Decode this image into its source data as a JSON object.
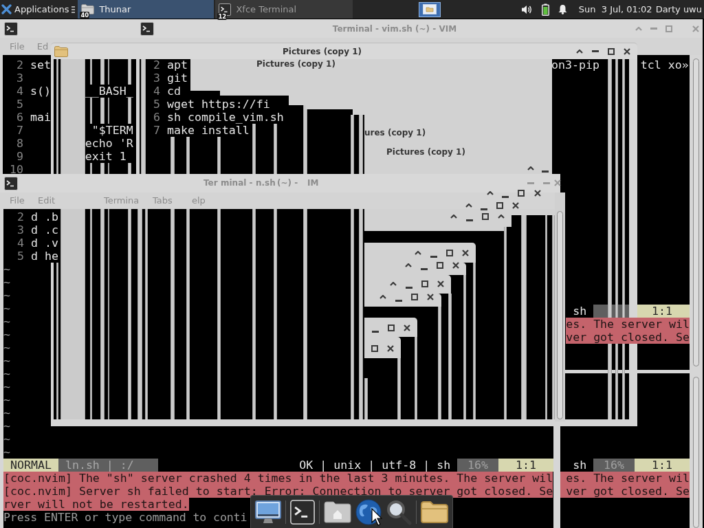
{
  "panel": {
    "applications": "Applications",
    "tasks": [
      {
        "kind": "folder",
        "badge": "40",
        "label": "Thunar",
        "selected": true
      },
      {
        "kind": "terminal",
        "badge": "12",
        "label": "Xfce Terminal",
        "selected": false
      }
    ],
    "clock": "Sun  3 Jul, 01:02",
    "user": "Darty uwu"
  },
  "terminal_back": {
    "menu": [
      "File",
      "Ed"
    ],
    "lines": [
      {
        "number": "2",
        "parts": [
          "set"
        ]
      },
      {
        "number": "3"
      },
      {
        "number": "4",
        "parts": [
          "s()",
          "__BASH_"
        ]
      },
      {
        "number": "5"
      },
      {
        "number": "6",
        "parts": [
          "mai"
        ]
      },
      {
        "number": "7",
        "parts": [
          "\"$TERM"
        ]
      },
      {
        "number": "8",
        "parts": [
          "echo 'R"
        ]
      },
      {
        "number": "9",
        "parts": [
          "exit 1"
        ]
      },
      {
        "number": "10"
      }
    ],
    "statusline": {
      "filetype": "sh",
      "percent": "16%",
      "position": "1:1"
    },
    "messages": [
      "es. The server wil",
      "ver got closed. Se"
    ]
  },
  "terminal_vim_sh": {
    "title": "Terminal - vim.sh (~) - VIM",
    "lines": [
      {
        "number": "2",
        "parts": [
          "apt",
          "on3-pip",
          "tcl xo»"
        ]
      },
      {
        "number": "3",
        "parts": [
          "git"
        ]
      },
      {
        "number": "4",
        "parts": [
          "cd"
        ]
      },
      {
        "number": "5",
        "parts": [
          "wget https://fi"
        ]
      },
      {
        "number": "6",
        "parts": [
          "sh compile_vim.sh"
        ]
      },
      {
        "number": "7",
        "parts": [
          "make install"
        ]
      }
    ],
    "statusline": {
      "filetype": "sh",
      "position": "1:1"
    },
    "messages": [
      "es. The server wil",
      "ver got closed. Se"
    ]
  },
  "file_manager": {
    "title": "Pictures (copy 1)",
    "trail_titles": [
      "Pictures (copy 1)",
      "ures (copy 1)",
      "Pictures (copy 1)"
    ]
  },
  "terminal_ln_sh": {
    "title_parts": [
      "Ter",
      "minal -",
      "n.sh",
      "(~) -",
      "IM"
    ],
    "menu": [
      "File",
      "Edit",
      "Termina",
      "Tabs",
      "elp"
    ],
    "lines": [
      {
        "number": "2",
        "parts": [
          "d .b"
        ]
      },
      {
        "number": "3",
        "parts": [
          "d .c"
        ]
      },
      {
        "number": "4",
        "parts": [
          "d .v"
        ]
      },
      {
        "number": "5",
        "parts": [
          "d he"
        ]
      }
    ],
    "tildes": [
      "~",
      "~",
      "~",
      "~",
      "~",
      "~",
      "~",
      "~",
      "~",
      "~",
      "~",
      "~",
      "~",
      "~",
      "~"
    ],
    "statusline": {
      "mode": "NORMAL",
      "file": "ln.sh | :/",
      "info": "OK | unix | utf-8 | sh",
      "percent": "16%",
      "position": "1:1"
    },
    "messages": [
      "[coc.nvim] The \"sh\" server crashed 4 times in the last 3 minutes. The server wil",
      "[coc.nvim] Server sh failed to start: Error: Connection to server got closed. Se",
      "rver will not be restarted."
    ],
    "prompt": "Press ENTER or type command to conti"
  }
}
